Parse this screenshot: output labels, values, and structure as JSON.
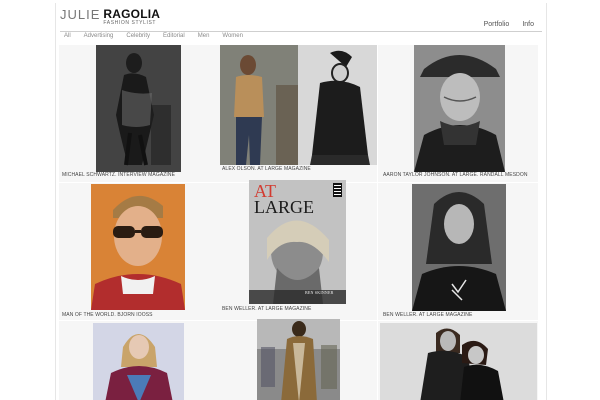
{
  "logo": {
    "first": "JULIE",
    "last": "RAGOLIA",
    "sub": "FASHION STYLIST"
  },
  "topnav": [
    "Portfolio",
    "Info"
  ],
  "filters": [
    "All",
    "Advertising",
    "Celebrity",
    "Editorial",
    "Men",
    "Women"
  ],
  "captions": {
    "c1": "MICHAEL SCHWARTZ. INTERVIEW MAGAZINE",
    "c2": "ALEX OLSON. AT LARGE MAGAZINE",
    "c3": "AARON TAYLOR JOHNSON. AT LARGE. RANDALL MESDON",
    "c4": "MAN OF THE WORLD. BJORN IOOSS",
    "c5": "BEN WELLER. AT LARGE MAGAZINE",
    "c6": "BEN WELLER. AT LARGE MAGAZINE"
  },
  "magazine": {
    "title_top": "AT",
    "title_bottom": "LARGE",
    "name": "BEN SKINNER"
  },
  "colors": {
    "accent_orange": "#d9813a",
    "rule": "#cfcfcf",
    "text": "#222222"
  }
}
